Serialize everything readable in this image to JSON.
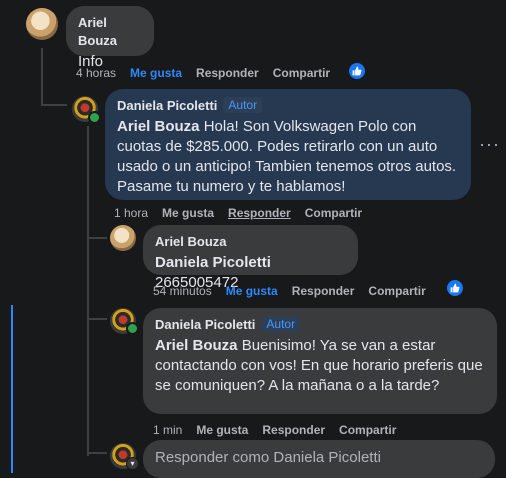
{
  "comments": [
    {
      "author": "Ariel Bouza",
      "text": "Info",
      "time": "4 horas",
      "like": "Me gusta",
      "reply": "Responder",
      "share": "Compartir"
    },
    {
      "author": "Daniela Picoletti",
      "badge": "Autor",
      "mention": "Ariel Bouza",
      "text": "Hola! Son Volkswagen Polo con cuotas de $285.000. Podes retirarlo con un auto usado o un anticipo! Tambien tenemos otros autos. Pasame tu numero y te hablamos!",
      "time": "1 hora",
      "like": "Me gusta",
      "reply": "Responder",
      "share": "Compartir"
    },
    {
      "author": "Ariel Bouza",
      "mention": "Daniela Picoletti",
      "text": "2665005472",
      "time": "54 minutos",
      "like": "Me gusta",
      "reply": "Responder",
      "share": "Compartir"
    },
    {
      "author": "Daniela Picoletti",
      "badge": "Autor",
      "mention": "Ariel Bouza",
      "text": "Buenisimo! Ya se van a estar contactando con vos! En que horario preferis que se comuniquen? A la mañana o a la tarde?",
      "time": "1 min",
      "like": "Me gusta",
      "reply": "Responder",
      "share": "Compartir"
    }
  ],
  "reply_box": {
    "placeholder": "Responder como Daniela Picoletti"
  },
  "more_glyph": "···",
  "colors": {
    "accent": "#2d88ff",
    "author_bubble": "#263951",
    "bubble": "#3a3b3c"
  }
}
